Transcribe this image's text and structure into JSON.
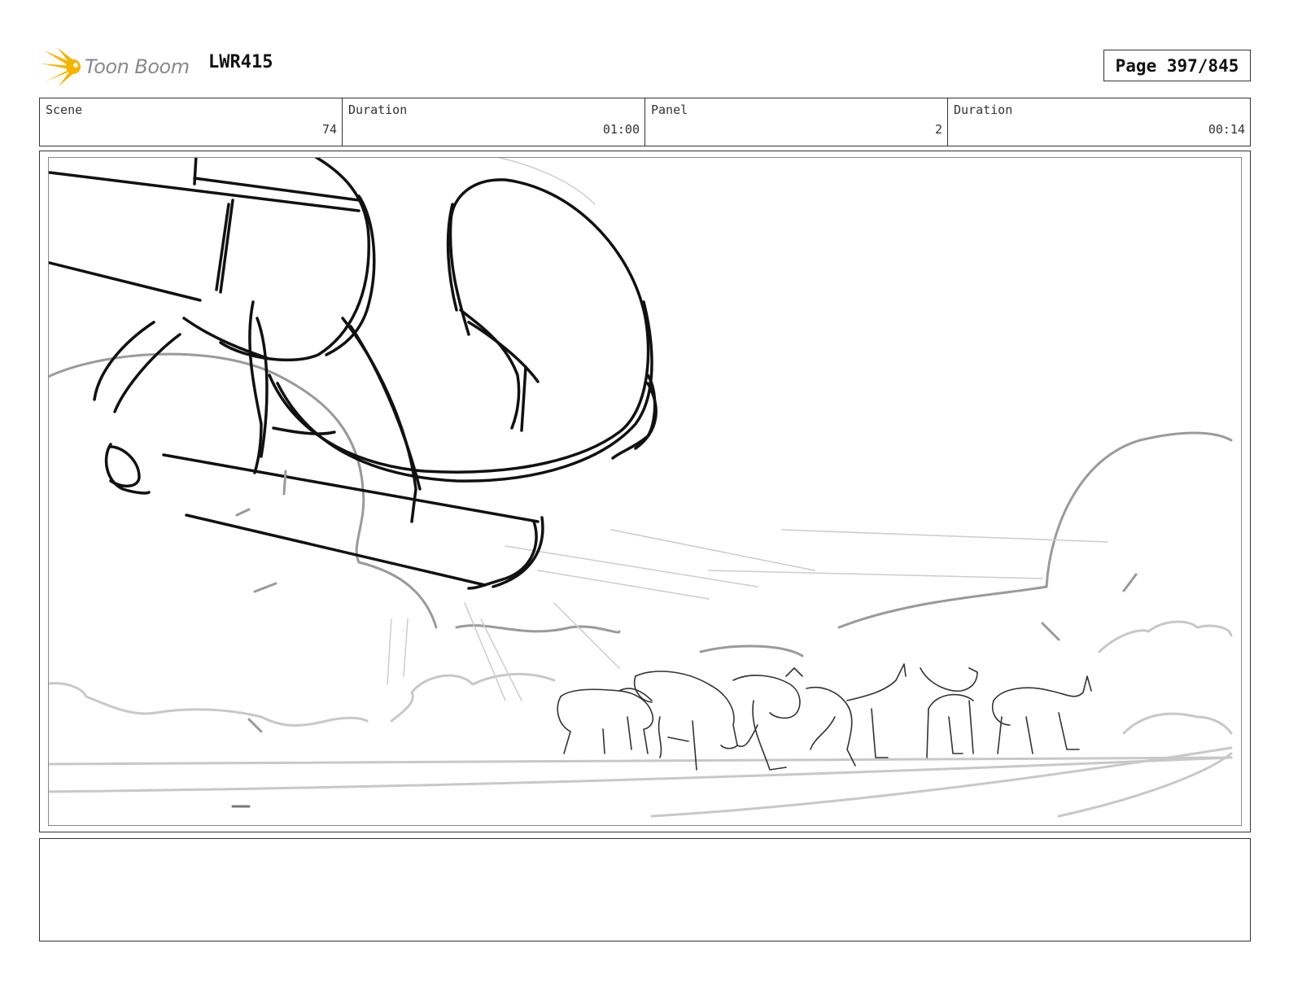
{
  "header": {
    "logo_text": "Toon Boom",
    "project": "LWR415",
    "page_label": "Page 397/845"
  },
  "info": {
    "scene_label": "Scene",
    "scene_value": "74",
    "scene_duration_label": "Duration",
    "scene_duration_value": "01:00",
    "panel_label": "Panel",
    "panel_value": "2",
    "panel_duration_label": "Duration",
    "panel_duration_value": "00:14"
  },
  "notes": {
    "text": ""
  },
  "colors": {
    "logo_accent": "#f5b400",
    "ink": "#111111",
    "sketch_gray": "#9a9a9a",
    "light_gray": "#c8c8c8"
  },
  "icons": {
    "logo": "toon-boom-logo"
  }
}
